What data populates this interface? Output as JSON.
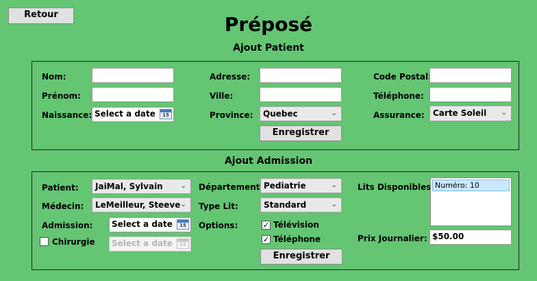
{
  "header": {
    "back_label": "Retour",
    "title": "Préposé"
  },
  "patient": {
    "section_title": "Ajout Patient",
    "nom_label": "Nom:",
    "nom_value": "",
    "prenom_label": "Prénom:",
    "prenom_value": "",
    "naissance_label": "Naissance:",
    "naissance_placeholder": "Select a date",
    "adresse_label": "Adresse:",
    "adresse_value": "",
    "ville_label": "Ville:",
    "ville_value": "",
    "province_label": "Province:",
    "province_value": "Quebec",
    "code_postal_label": "Code Postal:",
    "code_postal_value": "",
    "telephone_label": "Téléphone:",
    "telephone_value": "",
    "assurance_label": "Assurance:",
    "assurance_value": "Carte Soleil",
    "save_label": "Enregistrer"
  },
  "admission": {
    "section_title": "Ajout Admission",
    "patient_label": "Patient:",
    "patient_value": "JaiMal, Sylvain",
    "medecin_label": "Médecin:",
    "medecin_value": "LeMeilleur, Steeve",
    "admission_label": "Admission:",
    "admission_placeholder": "Select a date",
    "chirurgie_label": "Chirurgie",
    "chirurgie_checked": false,
    "chirurgie_placeholder": "Select a date",
    "departement_label": "Département:",
    "departement_value": "Pediatrie",
    "type_lit_label": "Type Lit:",
    "type_lit_value": "Standard",
    "options_label": "Options:",
    "television_label": "Télévision",
    "television_checked": true,
    "telephone_label": "Téléphone",
    "telephone_checked": true,
    "lits_label": "Lits Disponibles:",
    "lits_items": [
      "Numéro: 10"
    ],
    "prix_label": "Prix Journalier:",
    "prix_value": "$50.00",
    "save_label": "Enregistrer"
  },
  "icons": {
    "calendar": "calendar-icon",
    "chevron": "chevron-down-icon",
    "check": "checkmark-icon"
  },
  "calendar_day": "15",
  "colors": {
    "background": "#64c573",
    "selection": "#cce8ff"
  }
}
